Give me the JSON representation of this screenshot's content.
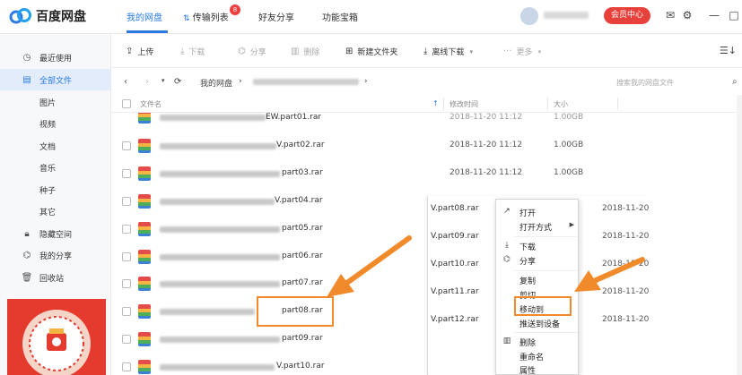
{
  "app": {
    "name": "百度网盘"
  },
  "nav": [
    {
      "label": "我的网盘",
      "active": true
    },
    {
      "label": "传输列表",
      "badge": "8"
    },
    {
      "label": "好友分享"
    },
    {
      "label": "功能宝箱"
    }
  ],
  "header": {
    "vip_label": "会员中心"
  },
  "icons": {
    "mail": "mail-icon",
    "settings": "gear-icon",
    "minimize": "minimize-icon",
    "maximize": "maximize-icon",
    "sort": "sort-icon"
  },
  "sidebar": [
    {
      "label": "最近使用",
      "icon": "clock-icon"
    },
    {
      "label": "全部文件",
      "icon": "file-icon",
      "active": true
    },
    {
      "label": "图片",
      "sub": true
    },
    {
      "label": "视频",
      "sub": true
    },
    {
      "label": "文档",
      "sub": true
    },
    {
      "label": "音乐",
      "sub": true
    },
    {
      "label": "种子",
      "sub": true
    },
    {
      "label": "其它",
      "sub": true
    },
    {
      "label": "隐藏空间",
      "icon": "lock-icon"
    },
    {
      "label": "我的分享",
      "icon": "share-icon"
    },
    {
      "label": "回收站",
      "icon": "trash-icon"
    }
  ],
  "toolbar": {
    "upload": "上传",
    "download": "下载",
    "share": "分享",
    "delete": "删除",
    "new_folder": "新建文件夹",
    "offline_download": "离线下载",
    "more": "更多"
  },
  "path": {
    "root": "我的网盘",
    "search_placeholder": "搜索我的网盘文件"
  },
  "table": {
    "headers": {
      "name": "文件名",
      "modified": "修改时间",
      "size": "大小"
    },
    "rows": [
      {
        "name": "EW.part01.rar",
        "date": "2018-11-20 11:12",
        "size": "1.00GB"
      },
      {
        "name": "V.part02.rar",
        "date": "2018-11-20 11:12",
        "size": "1.00GB"
      },
      {
        "name": "part03.rar",
        "date": "2018-11-20 11:12",
        "size": "1.00GB"
      },
      {
        "name": "V.part04.rar",
        "date": "2018-11-20 11:12",
        "size": "1.00GB"
      },
      {
        "name": "part05.rar",
        "date": "",
        "size": ""
      },
      {
        "name": "part06.rar",
        "date": "",
        "size": ""
      },
      {
        "name": "part07.rar",
        "date": "",
        "size": ""
      },
      {
        "name": "part08.rar",
        "date": "",
        "size": ""
      },
      {
        "name": "part09.rar",
        "date": "",
        "size": ""
      },
      {
        "name": "V.part10.rar",
        "date": "",
        "size": ""
      }
    ]
  },
  "overlay_rows": [
    {
      "name": "V.part08.rar",
      "date": "2018-11-20"
    },
    {
      "name": "V.part09.rar",
      "date": "2018-11-20"
    },
    {
      "name": "V.part10.rar",
      "date": "2018-11-20"
    },
    {
      "name": "V.part11.rar",
      "date": "2018-11-20"
    },
    {
      "name": "V.part12.rar",
      "date": "2018-11-20"
    }
  ],
  "context_menu": {
    "open": "打开",
    "open_with": "打开方式",
    "download": "下载",
    "share": "分享",
    "copy": "复制",
    "cut": "剪切",
    "move_to": "移动到",
    "push_device": "推送到设备",
    "delete": "删除",
    "rename": "重命名",
    "properties": "属性"
  },
  "colors": {
    "accent": "#2a7ae2",
    "annotation": "#f08a2b",
    "vip": "#e8403a"
  }
}
